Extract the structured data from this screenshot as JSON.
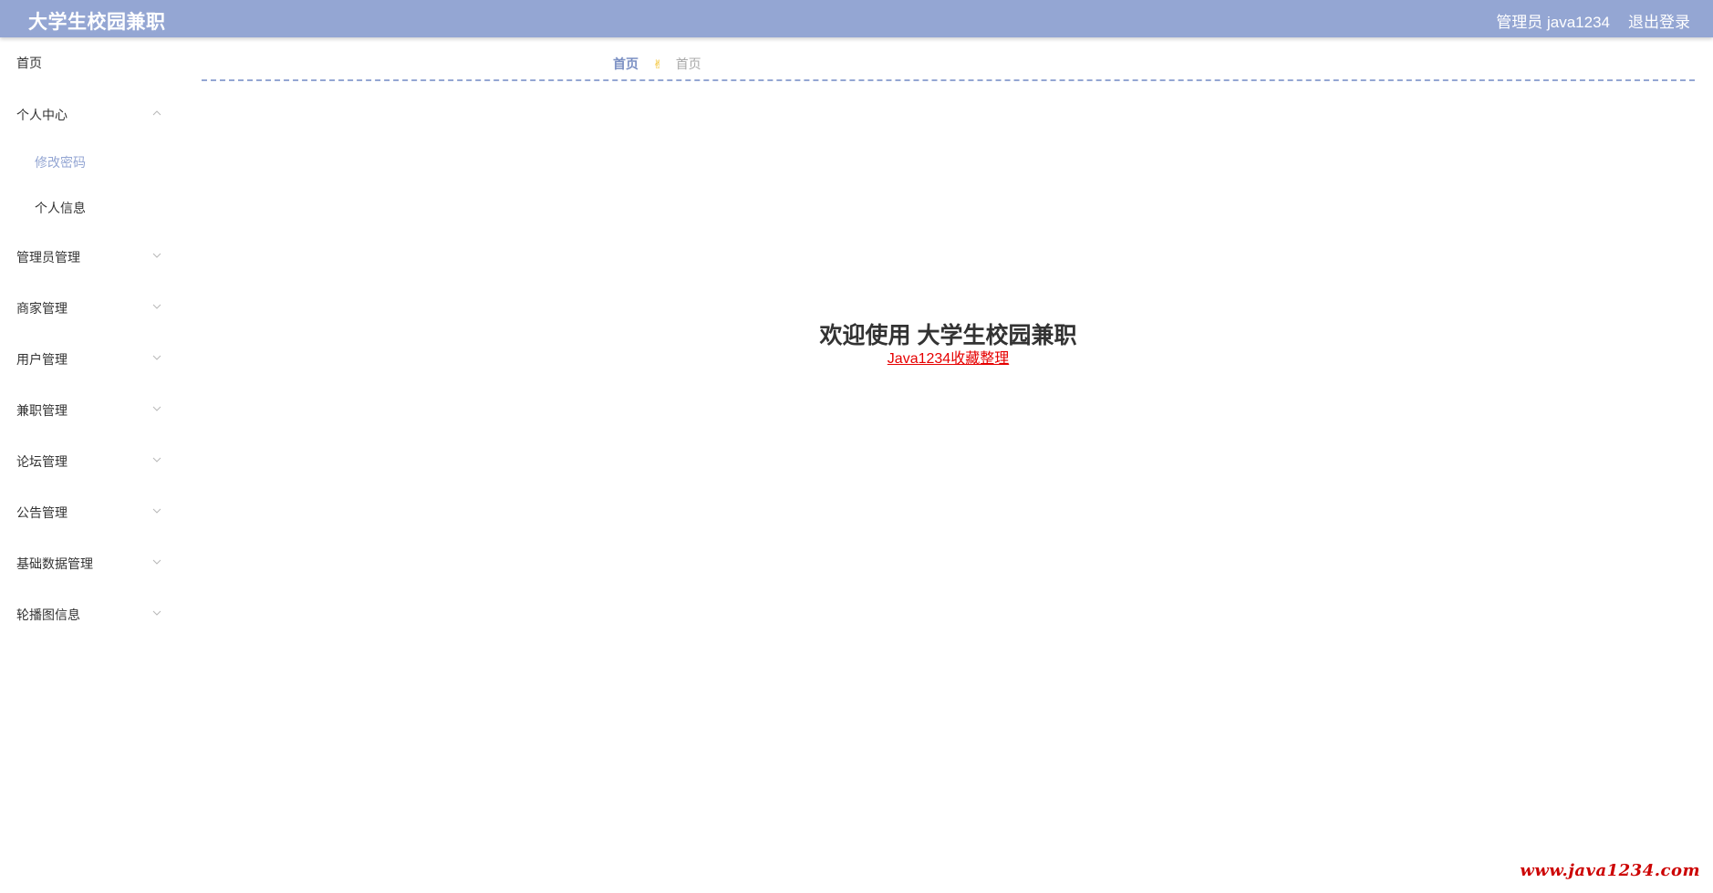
{
  "header": {
    "brand": "大学生校园兼职",
    "user_label": "管理员 java1234",
    "logout_label": "退出登录",
    "accent_color": "#94a6d3"
  },
  "sidebar": {
    "items": [
      {
        "label": "首页",
        "icon": ""
      },
      {
        "label": "个人中心",
        "icon": "chevron-up-icon"
      },
      {
        "label": "修改密码",
        "icon": ""
      },
      {
        "label": "个人信息",
        "icon": ""
      },
      {
        "label": "管理员管理",
        "icon": "chevron-down-icon"
      },
      {
        "label": "商家管理",
        "icon": "chevron-down-icon"
      },
      {
        "label": "用户管理",
        "icon": "chevron-down-icon"
      },
      {
        "label": "兼职管理",
        "icon": "chevron-down-icon"
      },
      {
        "label": "论坛管理",
        "icon": "chevron-down-icon"
      },
      {
        "label": "公告管理",
        "icon": "chevron-down-icon"
      },
      {
        "label": "基础数据管理",
        "icon": "chevron-down-icon"
      },
      {
        "label": "轮播图信息",
        "icon": "chevron-down-icon"
      }
    ]
  },
  "breadcrumb": {
    "home": "首页",
    "separator_icon": "hand-icon",
    "current": "首页"
  },
  "main": {
    "welcome_title": "欢迎使用 大学生校园兼职",
    "link_text": "Java1234收藏整理"
  },
  "watermark": {
    "text": "www.java1234.com"
  }
}
